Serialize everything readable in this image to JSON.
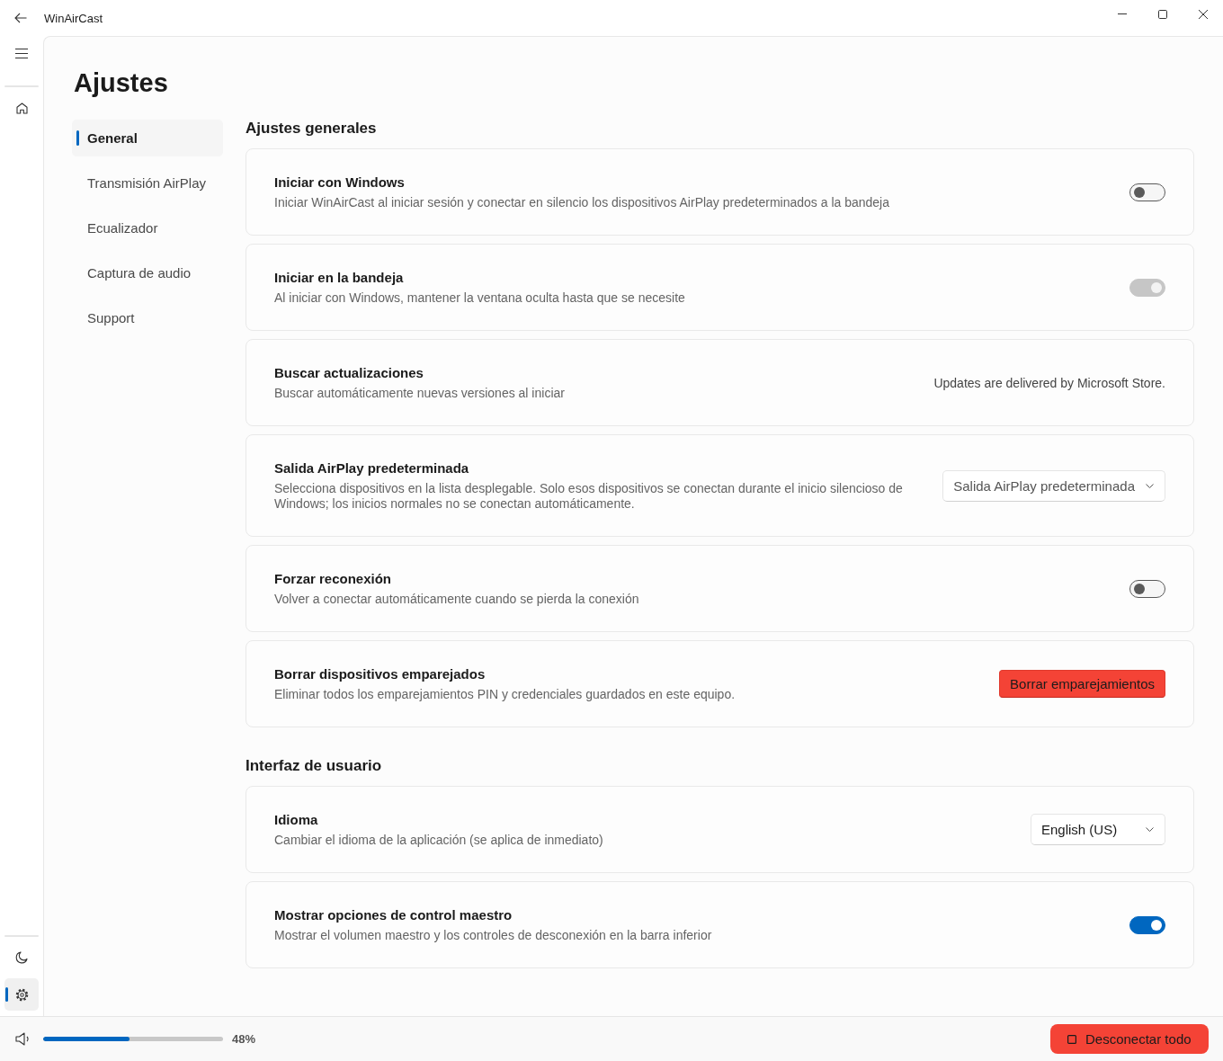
{
  "window": {
    "title": "WinAirCast"
  },
  "rail": {
    "items": [
      {
        "kind": "home",
        "selected": false
      }
    ],
    "footer_items": [
      {
        "kind": "theme",
        "selected": false
      },
      {
        "kind": "settings",
        "selected": true
      }
    ]
  },
  "page": {
    "title": "Ajustes"
  },
  "settings_nav": [
    {
      "label": "General",
      "selected": true
    },
    {
      "label": "Transmisión AirPlay",
      "selected": false
    },
    {
      "label": "Ecualizador",
      "selected": false
    },
    {
      "label": "Captura de audio",
      "selected": false
    },
    {
      "label": "Support",
      "selected": false
    }
  ],
  "sections": [
    {
      "heading": "Ajustes generales",
      "cards": [
        {
          "kind": "toggle",
          "title": "Iniciar con Windows",
          "description": "Iniciar WinAirCast al iniciar sesión y conectar en silencio los dispositivos AirPlay predeterminados a la bandeja",
          "on": false,
          "disabled": false
        },
        {
          "kind": "toggle",
          "title": "Iniciar en la bandeja",
          "description": "Al iniciar con Windows, mantener la ventana oculta hasta que se necesite",
          "on": true,
          "disabled": true
        },
        {
          "kind": "note",
          "title": "Buscar actualizaciones",
          "description": "Buscar automáticamente nuevas versiones al iniciar",
          "note": "Updates are delivered by Microsoft Store."
        },
        {
          "kind": "dropdown",
          "title": "Salida AirPlay predeterminada",
          "description": "Selecciona dispositivos en la lista desplegable. Solo esos dispositivos se conectan durante el inicio silencioso de Windows; los inicios normales no se conectan automáticamente.",
          "placeholder": "Salida AirPlay predeterminada"
        },
        {
          "kind": "toggle",
          "title": "Forzar reconexión",
          "description": "Volver a conectar automáticamente cuando se pierda la conexión",
          "on": false,
          "disabled": false
        },
        {
          "kind": "button",
          "title": "Borrar dispositivos emparejados",
          "description": "Eliminar todos los emparejamientos PIN y credenciales guardados en este equipo.",
          "button": "Borrar emparejamientos"
        }
      ]
    },
    {
      "heading": "Interfaz de usuario",
      "cards": [
        {
          "kind": "dropdown",
          "title": "Idioma",
          "description": "Cambiar el idioma de la aplicación (se aplica de inmediato)",
          "value": "English (US)"
        },
        {
          "kind": "toggle",
          "title": "Mostrar opciones de control maestro",
          "description": "Mostrar el volumen maestro y los controles de desconexión en la barra inferior",
          "on": true,
          "disabled": false
        }
      ]
    }
  ],
  "bottom_bar": {
    "volume": {
      "level": 0.48,
      "reading": "48%"
    },
    "disconnect_button": "Desconectar todo"
  }
}
